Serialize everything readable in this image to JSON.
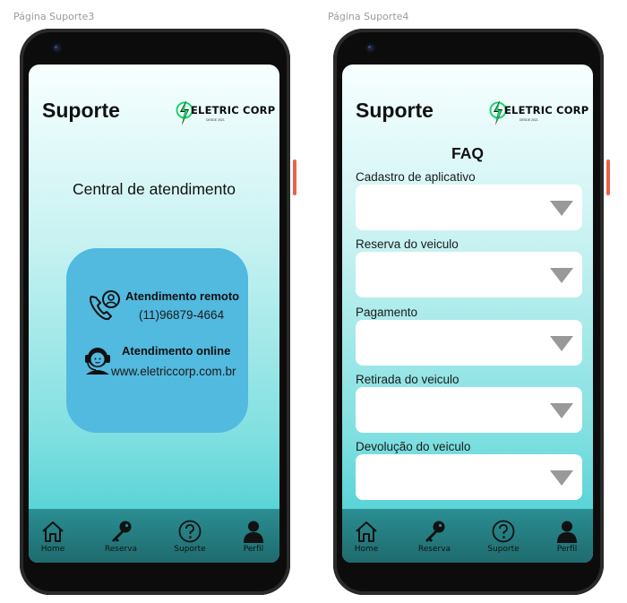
{
  "frames": [
    {
      "label": "Página Suporte3",
      "title": "Suporte",
      "logo": {
        "name": "ELETRIC CORP",
        "tagline": "DESDE 2021"
      },
      "heading": "Central de atendimento",
      "contacts": [
        {
          "title": "Atendimento remoto",
          "value": "(11)96879-4664",
          "icon": "phone-person-icon"
        },
        {
          "title": "Atendimento online",
          "value": "www.eletriccorp.com.br",
          "icon": "headset-agent-icon"
        }
      ],
      "nav": [
        {
          "label": "Home",
          "icon": "home-icon"
        },
        {
          "label": "Reserva",
          "icon": "key-icon"
        },
        {
          "label": "Suporte",
          "icon": "question-icon"
        },
        {
          "label": "Perfil",
          "icon": "user-icon"
        }
      ]
    },
    {
      "label": "Página Suporte4",
      "title": "Suporte",
      "logo": {
        "name": "ELETRIC CORP",
        "tagline": "DESDE 2021"
      },
      "heading": "FAQ",
      "faq": [
        {
          "label": "Cadastro de aplicativo",
          "value": ""
        },
        {
          "label": "Reserva do veiculo",
          "value": ""
        },
        {
          "label": "Pagamento",
          "value": ""
        },
        {
          "label": "Retirada do veiculo",
          "value": ""
        },
        {
          "label": "Devolução do veiculo",
          "value": ""
        }
      ],
      "nav": [
        {
          "label": "Home",
          "icon": "home-icon"
        },
        {
          "label": "Reserva",
          "icon": "key-icon"
        },
        {
          "label": "Suporte",
          "icon": "question-icon"
        },
        {
          "label": "Perfil",
          "icon": "user-icon"
        }
      ]
    }
  ],
  "colors": {
    "accent_side_button": "#e7624a",
    "contact_card": "#52b9df",
    "nav_bar": "#2a8e92",
    "logo_bolt": "#1fd36b"
  }
}
